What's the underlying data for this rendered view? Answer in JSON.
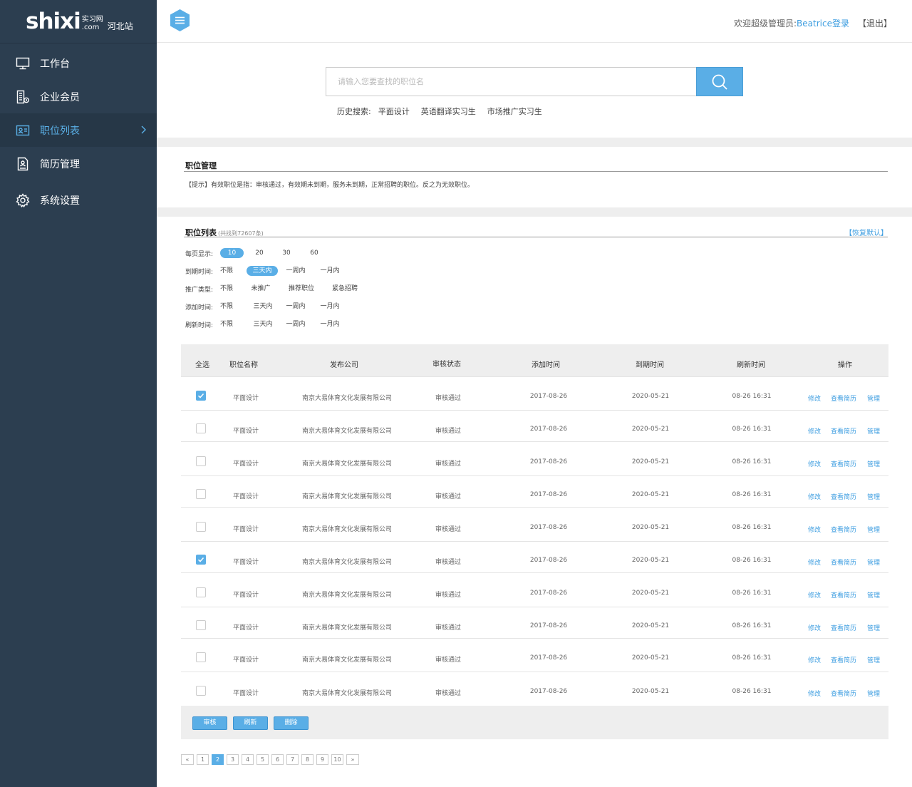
{
  "brand": {
    "logo_main": "shixi",
    "logo_sub_top": "实习网",
    "logo_sub_bottom": ".com",
    "site": "河北站"
  },
  "sidebar": {
    "items": [
      {
        "label": "工作台",
        "icon": "monitor-icon"
      },
      {
        "label": "企业会员",
        "icon": "building-icon"
      },
      {
        "label": "职位列表",
        "icon": "id-card-icon",
        "active": true
      },
      {
        "label": "简历管理",
        "icon": "document-icon"
      },
      {
        "label": "系统设置",
        "icon": "gear-icon"
      }
    ]
  },
  "header": {
    "welcome_prefix": "欢迎超级管理员:",
    "user": "Beatrice登录",
    "logout": "【退出】"
  },
  "search": {
    "placeholder": "请输入您要查找的职位名",
    "history_label": "历史搜索:",
    "history": [
      "平面设计",
      "英语翻译实习生",
      "市场推广实习生"
    ]
  },
  "manage": {
    "title": "职位管理",
    "tip": "【提示】有效职位是指：审核通过，有效期未到期，服务未到期，正常招聘的职位。反之为无效职位。"
  },
  "list": {
    "title": "职位列表",
    "count_note": "(共找到72607条)",
    "restore": "【恢复默认】"
  },
  "filters": {
    "per_page": {
      "label": "每页显示:",
      "options": [
        "10",
        "20",
        "30",
        "60"
      ],
      "selected": "10"
    },
    "expire": {
      "label": "到期时间:",
      "options": [
        "不限",
        "三天内",
        "一周内",
        "一月内"
      ],
      "selected": "三天内"
    },
    "promo": {
      "label": "推广类型:",
      "options": [
        "不限",
        "未推广",
        "推荐职位",
        "紧急招聘"
      ]
    },
    "added": {
      "label": "添加时间:",
      "options": [
        "不限",
        "三天内",
        "一周内",
        "一月内"
      ]
    },
    "refresh": {
      "label": "刷新时间:",
      "options": [
        "不限",
        "三天内",
        "一周内",
        "一月内"
      ]
    }
  },
  "table": {
    "headers": {
      "select_all": "全选",
      "name": "职位名称",
      "company": "发布公司",
      "status": "审核状态",
      "added": "添加时间",
      "expire": "到期时间",
      "refreshed": "刷新时间",
      "ops": "操作"
    },
    "rows": [
      {
        "checked": true,
        "name": "平面设计",
        "company": "南京大易体育文化发展有限公司",
        "status": "审核通过",
        "added": "2017-08-26",
        "expire": "2020-05-21",
        "refreshed": "08-26 16:31"
      },
      {
        "checked": false,
        "name": "平面设计",
        "company": "南京大易体育文化发展有限公司",
        "status": "审核通过",
        "added": "2017-08-26",
        "expire": "2020-05-21",
        "refreshed": "08-26 16:31"
      },
      {
        "checked": false,
        "name": "平面设计",
        "company": "南京大易体育文化发展有限公司",
        "status": "审核通过",
        "added": "2017-08-26",
        "expire": "2020-05-21",
        "refreshed": "08-26 16:31"
      },
      {
        "checked": false,
        "name": "平面设计",
        "company": "南京大易体育文化发展有限公司",
        "status": "审核通过",
        "added": "2017-08-26",
        "expire": "2020-05-21",
        "refreshed": "08-26 16:31"
      },
      {
        "checked": false,
        "name": "平面设计",
        "company": "南京大易体育文化发展有限公司",
        "status": "审核通过",
        "added": "2017-08-26",
        "expire": "2020-05-21",
        "refreshed": "08-26 16:31"
      },
      {
        "checked": true,
        "name": "平面设计",
        "company": "南京大易体育文化发展有限公司",
        "status": "审核通过",
        "added": "2017-08-26",
        "expire": "2020-05-21",
        "refreshed": "08-26 16:31"
      },
      {
        "checked": false,
        "name": "平面设计",
        "company": "南京大易体育文化发展有限公司",
        "status": "审核通过",
        "added": "2017-08-26",
        "expire": "2020-05-21",
        "refreshed": "08-26 16:31"
      },
      {
        "checked": false,
        "name": "平面设计",
        "company": "南京大易体育文化发展有限公司",
        "status": "审核通过",
        "added": "2017-08-26",
        "expire": "2020-05-21",
        "refreshed": "08-26 16:31"
      },
      {
        "checked": false,
        "name": "平面设计",
        "company": "南京大易体育文化发展有限公司",
        "status": "审核通过",
        "added": "2017-08-26",
        "expire": "2020-05-21",
        "refreshed": "08-26 16:31"
      },
      {
        "checked": false,
        "name": "平面设计",
        "company": "南京大易体育文化发展有限公司",
        "status": "审核通过",
        "added": "2017-08-26",
        "expire": "2020-05-21",
        "refreshed": "08-26 16:31"
      }
    ],
    "row_ops": [
      "修改",
      "查看简历",
      "管理"
    ],
    "actions": [
      "审核",
      "刷新",
      "删除"
    ]
  },
  "pagination": {
    "prev": "«",
    "next": "»",
    "pages": [
      "1",
      "2",
      "3",
      "4",
      "5",
      "6",
      "7",
      "8",
      "9",
      "10"
    ],
    "current": "2"
  },
  "colors": {
    "sidebar": "#2c3e50",
    "accent": "#5aaee6",
    "link": "#3c9de0"
  }
}
